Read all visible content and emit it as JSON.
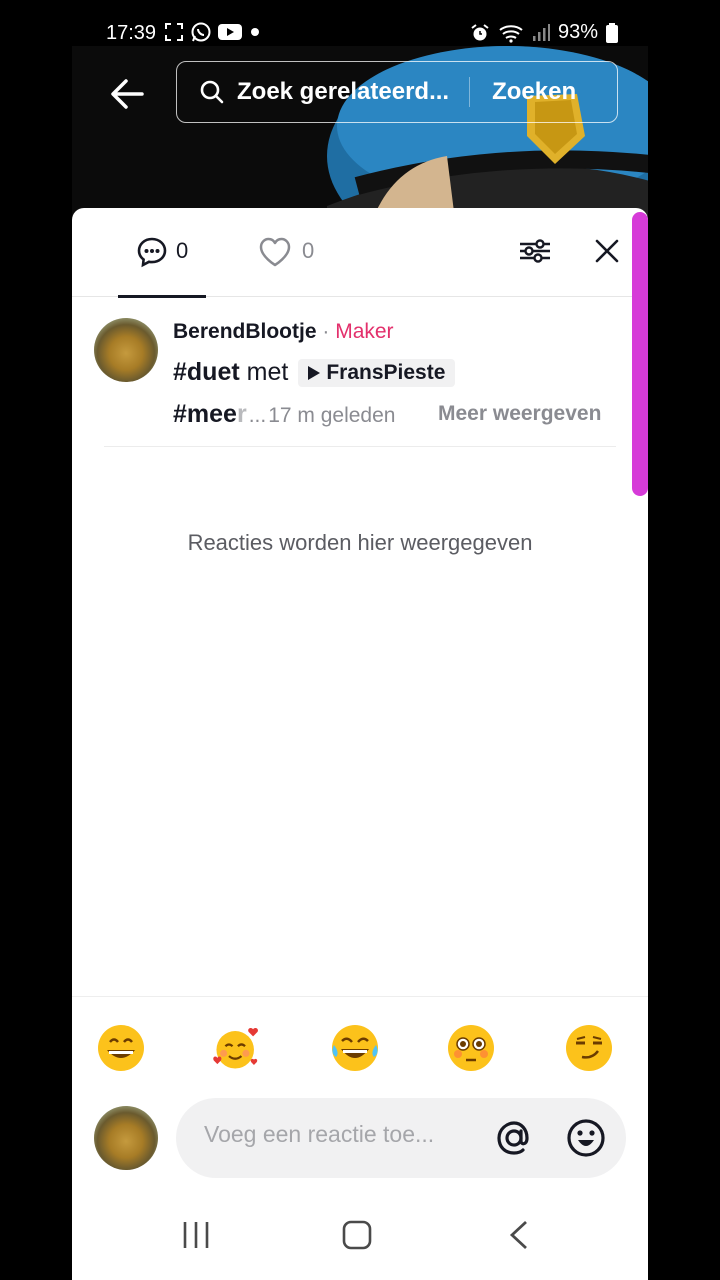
{
  "status_bar": {
    "time": "17:39",
    "battery": "93%"
  },
  "search": {
    "placeholder": "Zoek gerelateerd...",
    "button_label": "Zoeken"
  },
  "tabs": {
    "comments_count": "0",
    "likes_count": "0"
  },
  "comment": {
    "username": "BerendBlootje",
    "separator": "·",
    "role": "Maker",
    "hashtag1": "#duet",
    "text_with": "met",
    "mention": "FransPieste",
    "hashtag2_visible": "#mee",
    "hashtag2_faded": "r",
    "ellipsis": "...",
    "time": "17 m geleden",
    "more_label": "Meer weergeven"
  },
  "empty_message": "Reacties worden hier weergegeven",
  "emojis": [
    "grinning-face",
    "smiling-face-with-hearts",
    "face-with-tears-of-joy",
    "flushed-face",
    "smirking-face"
  ],
  "input": {
    "placeholder": "Voeg een reactie toe..."
  },
  "colors": {
    "maker": "#e3306c",
    "scrollbar": "#d63bd8",
    "sheet_bg": "#ffffff"
  }
}
